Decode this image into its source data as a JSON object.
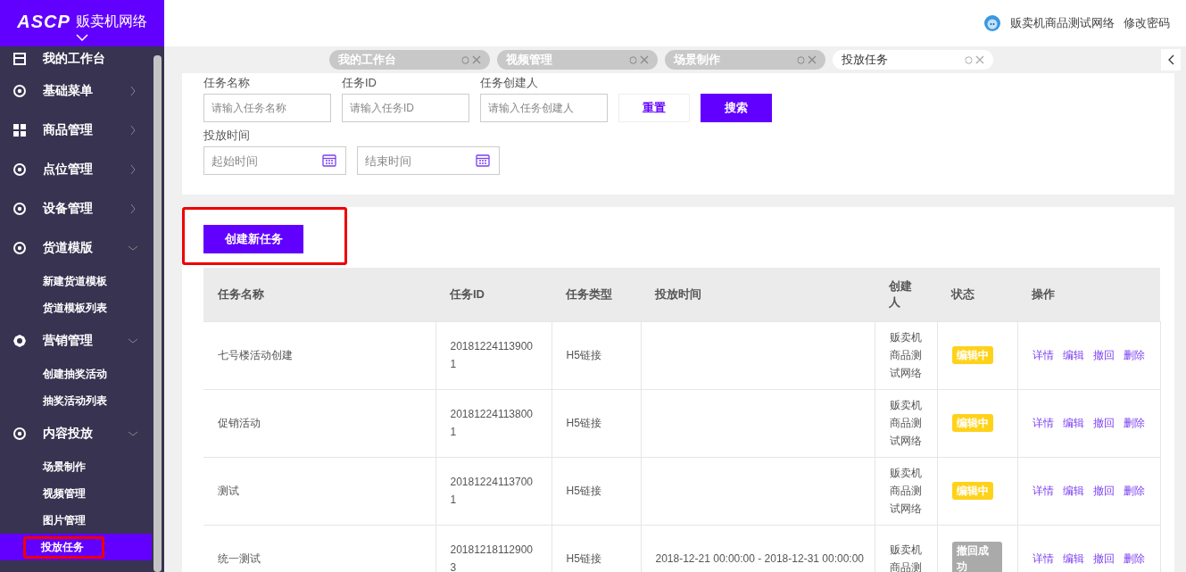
{
  "brand": {
    "logo": "ASCP",
    "name": "贩卖机网络"
  },
  "header": {
    "user": "贩卖机商品测试网络",
    "links": [
      "修改密码"
    ]
  },
  "sidebar": {
    "items": [
      {
        "label": "我的工作台",
        "has_arrow": false
      },
      {
        "label": "基础菜单",
        "expanded": false,
        "has_arrow": true
      },
      {
        "label": "商品管理",
        "expanded": false,
        "has_arrow": true
      },
      {
        "label": "点位管理",
        "expanded": false,
        "has_arrow": true
      },
      {
        "label": "设备管理",
        "expanded": false,
        "has_arrow": true
      },
      {
        "label": "货道模版",
        "expanded": true,
        "has_arrow": true,
        "children": [
          {
            "label": "新建货道模板",
            "selected": false
          },
          {
            "label": "货道模板列表",
            "selected": false
          }
        ]
      },
      {
        "label": "营销管理",
        "expanded": true,
        "has_arrow": true,
        "children": [
          {
            "label": "创建抽奖活动",
            "selected": false
          },
          {
            "label": "抽奖活动列表",
            "selected": false
          }
        ]
      },
      {
        "label": "内容投放",
        "expanded": true,
        "has_arrow": true,
        "children": [
          {
            "label": "场景制作",
            "selected": false
          },
          {
            "label": "视频管理",
            "selected": false
          },
          {
            "label": "图片管理",
            "selected": false
          },
          {
            "label": "投放任务",
            "selected": true,
            "highlighted": true
          }
        ]
      }
    ]
  },
  "tabs": [
    {
      "label": "我的工作台",
      "selected": false
    },
    {
      "label": "视频管理",
      "selected": false
    },
    {
      "label": "场景制作",
      "selected": false
    },
    {
      "label": "投放任务",
      "selected": true
    }
  ],
  "search": {
    "fields": [
      {
        "label": "任务名称",
        "placeholder": "请输入任务名称"
      },
      {
        "label": "任务ID",
        "placeholder": "请输入任务ID"
      },
      {
        "label": "任务创建人",
        "placeholder": "请输入任务创建人"
      }
    ],
    "buttons": [
      {
        "label": "重置",
        "kind": "plain"
      },
      {
        "label": "搜索",
        "kind": "primary"
      }
    ],
    "date_label": "投放时间",
    "date_fields": [
      {
        "placeholder": "起始时间"
      },
      {
        "placeholder": "结束时间"
      }
    ]
  },
  "create_button": {
    "label": "创建新任务",
    "highlighted": true
  },
  "table": {
    "columns": [
      "任务名称",
      "任务ID",
      "任务类型",
      "投放时间",
      "创建人",
      "状态",
      "操作"
    ],
    "rows": [
      {
        "name": "七号楼活动创建",
        "id": "201812241139001",
        "type": "H5链接",
        "time": "",
        "creator": "贩卖机商品测试网络",
        "status": {
          "text": "编辑中",
          "kind": "editing"
        },
        "actions": [
          "详情",
          "编辑",
          "撤回",
          "删除"
        ]
      },
      {
        "name": "促销活动",
        "id": "201812241138001",
        "type": "H5链接",
        "time": "",
        "creator": "贩卖机商品测试网络",
        "status": {
          "text": "编辑中",
          "kind": "editing"
        },
        "actions": [
          "详情",
          "编辑",
          "撤回",
          "删除"
        ]
      },
      {
        "name": "测试",
        "id": "201812241137001",
        "type": "H5链接",
        "time": "",
        "creator": "贩卖机商品测试网络",
        "status": {
          "text": "编辑中",
          "kind": "editing"
        },
        "actions": [
          "详情",
          "编辑",
          "撤回",
          "删除"
        ]
      },
      {
        "name": "统一测试",
        "id": "201812181129003",
        "type": "H5链接",
        "time": "2018-12-21 00:00:00 - 2018-12-31 00:00:00",
        "creator": "贩卖机商品测",
        "status": {
          "text": "撤回成功",
          "kind": "revoked"
        },
        "actions": [
          "详情",
          "编辑",
          "撤回",
          "删除"
        ]
      }
    ]
  }
}
